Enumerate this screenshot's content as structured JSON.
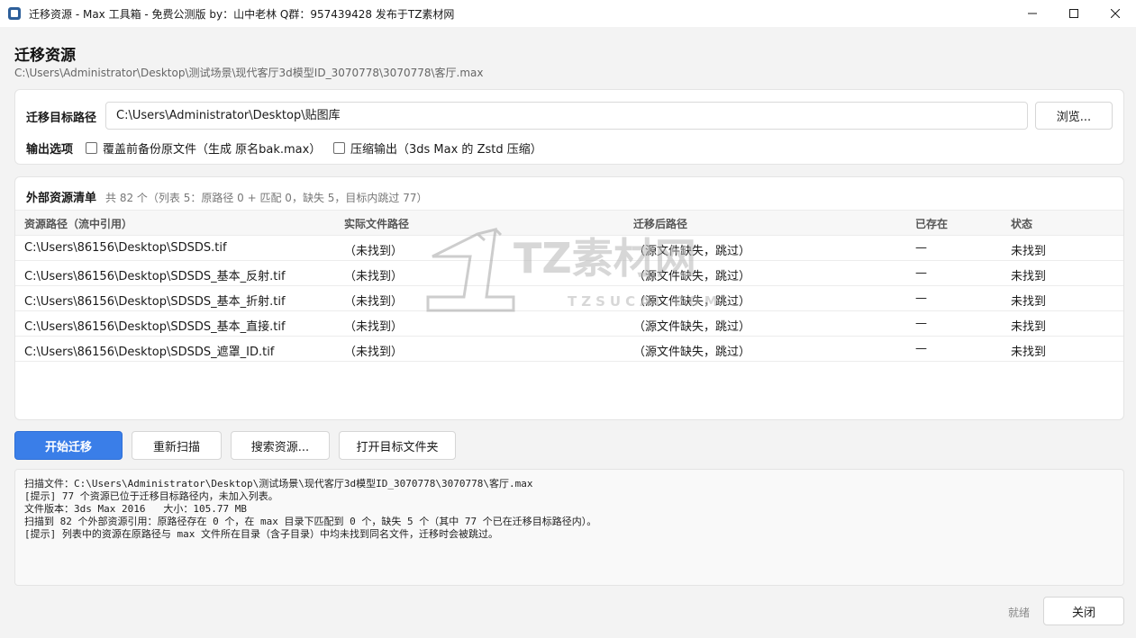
{
  "window": {
    "title": "迁移资源 - Max 工具箱 - 免费公测版 by：山中老林 Q群：957439428 发布于TZ素材网",
    "icon": "app-icon",
    "controls": [
      "minimize-icon",
      "maximize-icon",
      "close-icon"
    ]
  },
  "header": {
    "title": "迁移资源",
    "source_path": "C:\\Users\\Administrator\\Desktop\\测试场景\\现代客厅3d模型ID_3070778\\3070778\\客厅.max"
  },
  "options": {
    "target_label": "迁移目标路径",
    "target_value": "C:\\Users\\Administrator\\Desktop\\贴图库",
    "browse_label": "浏览...",
    "output_label": "输出选项",
    "backup_label": "覆盖前备份原文件（生成 原名bak.max）",
    "backup_checked": false,
    "compress_label": "压缩输出（3ds Max 的 Zstd 压缩）",
    "compress_checked": false
  },
  "resources": {
    "title": "外部资源清单",
    "summary": "共 82 个（列表 5：原路径 0 + 匹配 0，缺失 5，目标内跳过 77）",
    "columns": [
      "资源路径（流中引用）",
      "实际文件路径",
      "迁移后路径",
      "已存在",
      "状态"
    ],
    "rows": [
      {
        "source": "C:\\Users\\86156\\Desktop\\SDSDS.tif",
        "actual": "（未找到）",
        "target": "（源文件缺失，跳过）",
        "exists": "—",
        "status": "未找到"
      },
      {
        "source": "C:\\Users\\86156\\Desktop\\SDSDS_基本_反射.tif",
        "actual": "（未找到）",
        "target": "（源文件缺失，跳过）",
        "exists": "—",
        "status": "未找到"
      },
      {
        "source": "C:\\Users\\86156\\Desktop\\SDSDS_基本_折射.tif",
        "actual": "（未找到）",
        "target": "（源文件缺失，跳过）",
        "exists": "—",
        "status": "未找到"
      },
      {
        "source": "C:\\Users\\86156\\Desktop\\SDSDS_基本_直接.tif",
        "actual": "（未找到）",
        "target": "（源文件缺失，跳过）",
        "exists": "—",
        "status": "未找到"
      },
      {
        "source": "C:\\Users\\86156\\Desktop\\SDSDS_遮罩_ID.tif",
        "actual": "（未找到）",
        "target": "（源文件缺失，跳过）",
        "exists": "—",
        "status": "未找到"
      }
    ]
  },
  "watermark": {
    "main": "TZ素材网",
    "sub": "TZSUCAI.COM"
  },
  "actions": {
    "start": "开始迁移",
    "rescan": "重新扫描",
    "search": "搜索资源...",
    "open_target": "打开目标文件夹"
  },
  "log": [
    "扫描文件：C:\\Users\\Administrator\\Desktop\\测试场景\\现代客厅3d模型ID_3070778\\3070778\\客厅.max",
    "[提示] 77 个资源已位于迁移目标路径内，未加入列表。",
    "文件版本：3ds Max 2016   大小：105.77 MB",
    "扫描到 82 个外部资源引用：原路径存在 0 个，在 max 目录下匹配到 0 个，缺失 5 个（其中 77 个已在迁移目标路径内）。",
    "[提示] 列表中的资源在原路径与 max 文件所在目录（含子目录）中均未找到同名文件，迁移时会被跳过。"
  ],
  "footer": {
    "status": "就绪",
    "close": "关闭"
  },
  "colors": {
    "primary": "#3a7ee8",
    "background": "#f3f3f3",
    "card": "#ffffff"
  }
}
